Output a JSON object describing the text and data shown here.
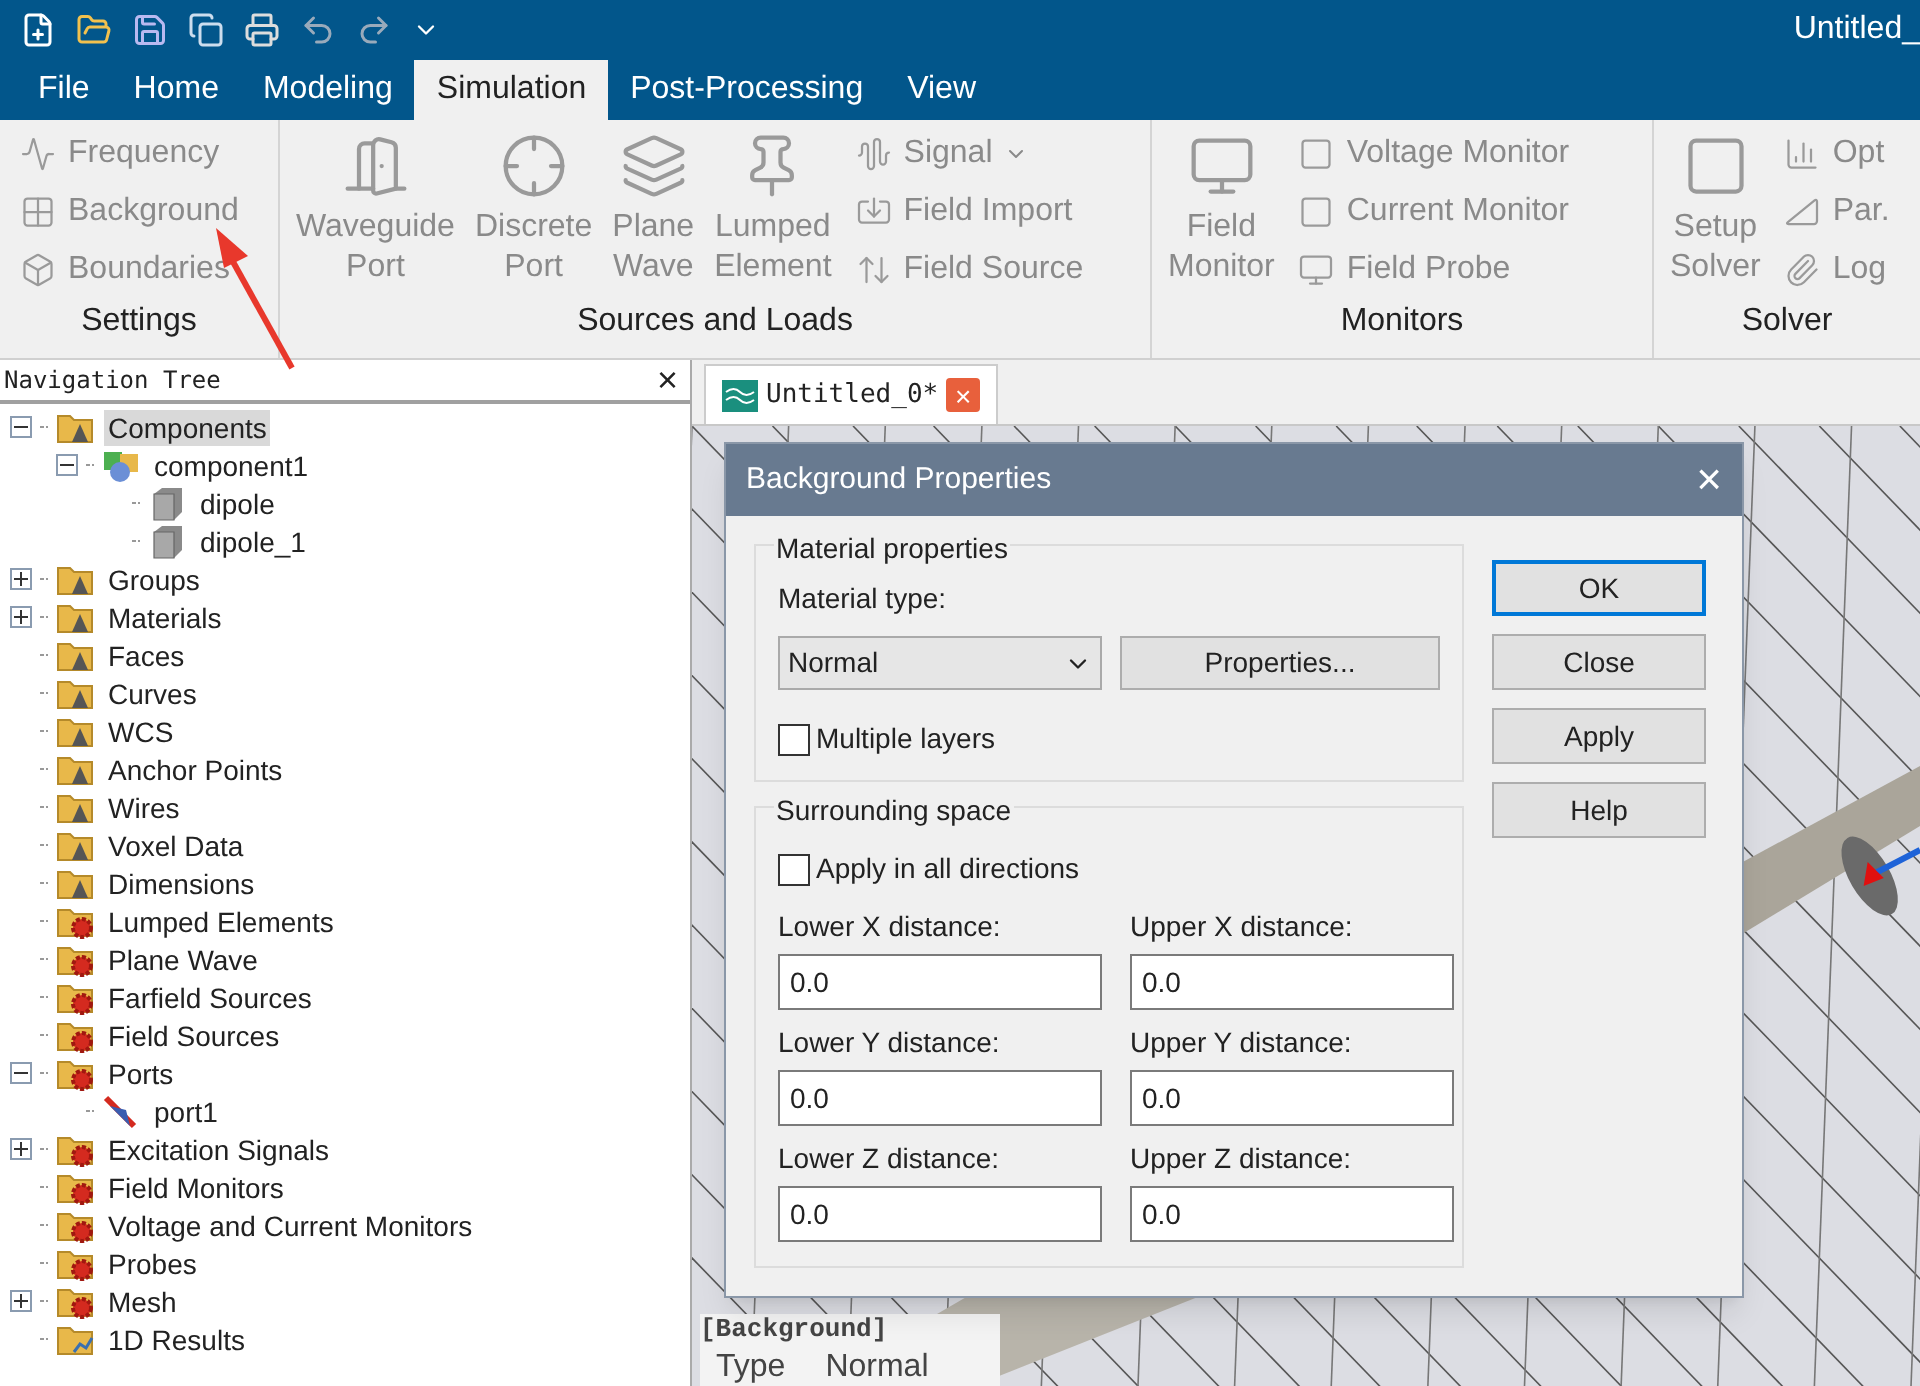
{
  "window": {
    "title": "Untitled_"
  },
  "tabs": [
    {
      "label": "File",
      "selected": false
    },
    {
      "label": "Home",
      "selected": false
    },
    {
      "label": "Modeling",
      "selected": false
    },
    {
      "label": "Simulation",
      "selected": true
    },
    {
      "label": "Post-Processing",
      "selected": false
    },
    {
      "label": "View",
      "selected": false
    }
  ],
  "ribbon": [
    {
      "label": "Settings",
      "small": [
        {
          "label": "Frequency",
          "disabled": true
        },
        {
          "label": "Background",
          "disabled": true
        },
        {
          "label": "Boundaries",
          "disabled": true
        }
      ]
    },
    {
      "label": "Sources and Loads",
      "large": [
        {
          "label": "Waveguide\nPort",
          "disabled": true
        },
        {
          "label": "Discrete\nPort",
          "disabled": true
        },
        {
          "label": "Plane\nWave",
          "disabled": true
        },
        {
          "label": "Lumped\nElement",
          "disabled": true
        }
      ],
      "small": [
        {
          "label": "Signal",
          "disabled": true,
          "dropdown": true
        },
        {
          "label": "Field Import",
          "disabled": true
        },
        {
          "label": "Field Source",
          "disabled": true
        }
      ]
    },
    {
      "label": "Monitors",
      "large": [
        {
          "label": "Field\nMonitor",
          "disabled": true
        }
      ],
      "small": [
        {
          "label": "Voltage Monitor",
          "disabled": true
        },
        {
          "label": "Current Monitor",
          "disabled": true
        },
        {
          "label": "Field Probe",
          "disabled": true
        }
      ]
    },
    {
      "label": "Solver",
      "large": [
        {
          "label": "Setup\nSolver",
          "disabled": true
        }
      ],
      "small": [
        {
          "label": "Opt",
          "disabled": true
        },
        {
          "label": "Par.",
          "disabled": true
        },
        {
          "label": "Log",
          "disabled": true
        }
      ]
    }
  ],
  "navigation_tree": {
    "title": "Navigation Tree",
    "close": "×",
    "items": [
      {
        "label": "Components",
        "kind": "folder",
        "expanded": true,
        "selected": true,
        "children": [
          {
            "label": "component1",
            "kind": "component",
            "expanded": true,
            "selected": false,
            "children": [
              {
                "label": "dipole",
                "kind": "solid",
                "selected": false
              },
              {
                "label": "dipole_1",
                "kind": "solid",
                "selected": false
              }
            ]
          }
        ]
      },
      {
        "label": "Groups",
        "kind": "folder",
        "expanded": false,
        "selected": false
      },
      {
        "label": "Materials",
        "kind": "folder",
        "expanded": false,
        "selected": false
      },
      {
        "label": "Faces",
        "kind": "folder",
        "selected": false
      },
      {
        "label": "Curves",
        "kind": "folder",
        "selected": false
      },
      {
        "label": "WCS",
        "kind": "folder",
        "selected": false
      },
      {
        "label": "Anchor Points",
        "kind": "folder",
        "selected": false
      },
      {
        "label": "Wires",
        "kind": "folder",
        "selected": false
      },
      {
        "label": "Voxel Data",
        "kind": "folder",
        "selected": false
      },
      {
        "label": "Dimensions",
        "kind": "folder",
        "selected": false
      },
      {
        "label": "Lumped Elements",
        "kind": "gearfolder",
        "selected": false
      },
      {
        "label": "Plane Wave",
        "kind": "gearfolder",
        "selected": false
      },
      {
        "label": "Farfield Sources",
        "kind": "gearfolder",
        "selected": false
      },
      {
        "label": "Field Sources",
        "kind": "gearfolder",
        "selected": false
      },
      {
        "label": "Ports",
        "kind": "gearfolder",
        "expanded": true,
        "selected": false,
        "children": [
          {
            "label": "port1",
            "kind": "port",
            "selected": false
          }
        ]
      },
      {
        "label": "Excitation Signals",
        "kind": "gearfolder",
        "expanded": false,
        "selected": false
      },
      {
        "label": "Field Monitors",
        "kind": "gearfolder",
        "selected": false
      },
      {
        "label": "Voltage and Current Monitors",
        "kind": "gearfolder",
        "selected": false
      },
      {
        "label": "Probes",
        "kind": "gearfolder",
        "selected": false
      },
      {
        "label": "Mesh",
        "kind": "gearfolder",
        "expanded": false,
        "selected": false
      },
      {
        "label": "1D Results",
        "kind": "resultfolder",
        "selected": false
      }
    ]
  },
  "document_tab": {
    "label": "Untitled_0*",
    "close": "×"
  },
  "dialog": {
    "title": "Background Properties",
    "close": "×",
    "material": {
      "legend": "Material properties",
      "type_label": "Material type:",
      "type_value": "Normal",
      "properties_button": "Properties...",
      "multiple_layers": {
        "label": "Multiple layers",
        "checked": false
      }
    },
    "surrounding": {
      "legend": "Surrounding space",
      "all_directions": {
        "label": "Apply in all directions",
        "checked": false
      },
      "fields": [
        {
          "label": "Lower X distance:",
          "value": "0.0"
        },
        {
          "label": "Upper X distance:",
          "value": "0.0"
        },
        {
          "label": "Lower Y distance:",
          "value": "0.0"
        },
        {
          "label": "Upper Y distance:",
          "value": "0.0"
        },
        {
          "label": "Lower Z distance:",
          "value": "0.0"
        },
        {
          "label": "Upper Z distance:",
          "value": "0.0"
        }
      ]
    },
    "buttons": [
      {
        "label": "OK",
        "default": true
      },
      {
        "label": "Close",
        "default": false
      },
      {
        "label": "Apply",
        "default": false
      },
      {
        "label": "Help",
        "default": false
      }
    ]
  },
  "properties_panel": {
    "header": "[Background]",
    "rows": [
      {
        "name": "Type",
        "value": "Normal"
      }
    ]
  }
}
